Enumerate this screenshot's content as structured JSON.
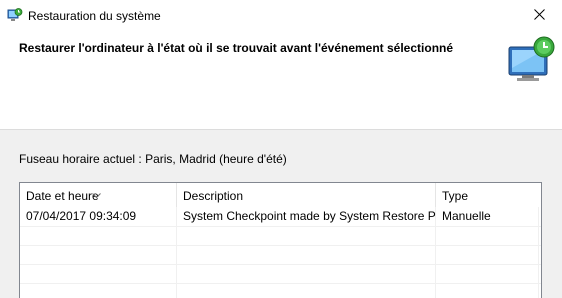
{
  "window": {
    "title": "Restauration du système",
    "header": "Restaurer l'ordinateur à l'état où il se trouvait avant l'événement sélectionné"
  },
  "timezone_label": "Fuseau horaire actuel : Paris, Madrid (heure d'été)",
  "table": {
    "columns": [
      "Date et heure",
      "Description",
      "Type"
    ],
    "rows": [
      [
        "07/04/2017 09:34:09",
        "System Checkpoint made by System Restore Poi...",
        "Manuelle"
      ]
    ]
  },
  "icons": {
    "app": "system-restore-icon",
    "header": "computer-restore-icon",
    "close": "close-icon",
    "sort": "sort-descending-icon"
  }
}
